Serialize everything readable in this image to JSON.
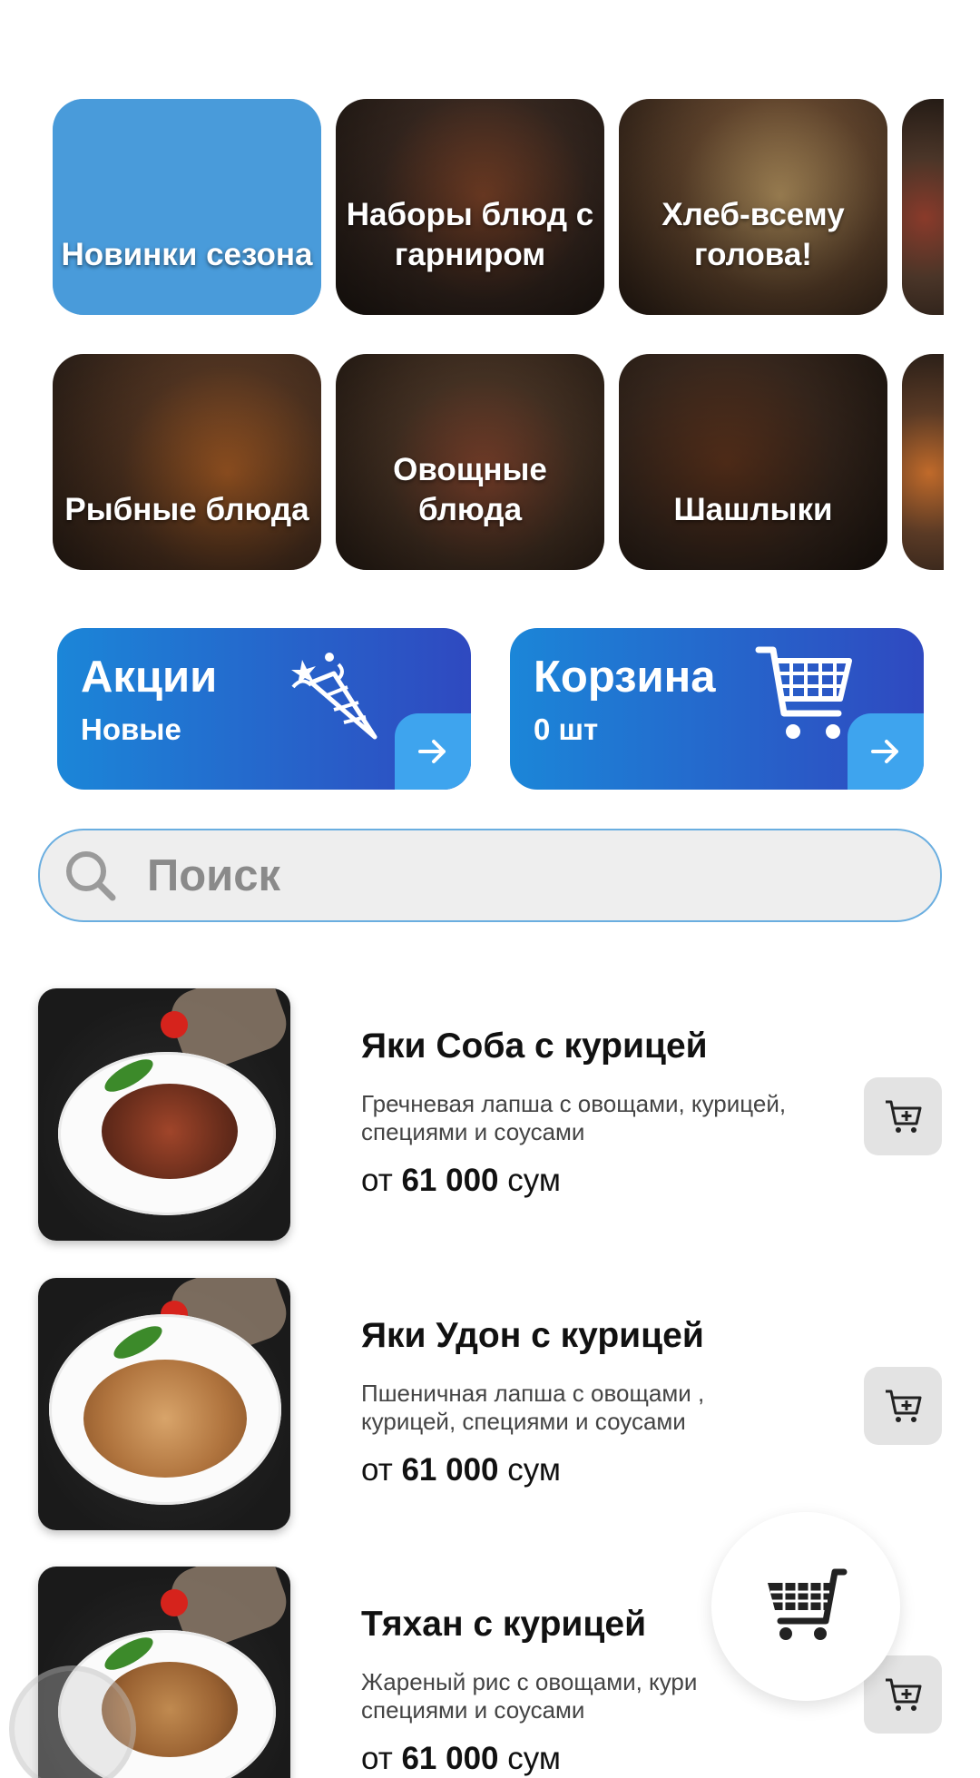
{
  "categories": {
    "row1": [
      {
        "label": "Новинки сезона"
      },
      {
        "label": "Наборы блюд с гарниром"
      },
      {
        "label": "Хлеб-всему голова!"
      }
    ],
    "row2": [
      {
        "label": "Рыбные блюда"
      },
      {
        "label": "Овощные блюда"
      },
      {
        "label": "Шашлыки"
      }
    ]
  },
  "promos": {
    "sales": {
      "title": "Акции",
      "subtitle": "Новые"
    },
    "cart": {
      "title": "Корзина",
      "subtitle": "0 шт"
    }
  },
  "search": {
    "placeholder": "Поиск"
  },
  "products": [
    {
      "name": "Яки Соба с курицей",
      "description": "Гречневая лапша с овощами, курицей, специями и соусами",
      "price_prefix": "от",
      "price": "61 000",
      "currency": "сум"
    },
    {
      "name": "Яки Удон с курицей",
      "description": "Пшеничная лапша с овощами , курицей, специями и соусами",
      "price_prefix": "от",
      "price": "61 000",
      "currency": "сум"
    },
    {
      "name": "Тяхан с курицей",
      "description": "Жареный рис с овощами, кури специями и соусами",
      "price_prefix": "от",
      "price": "61 000",
      "currency": "сум"
    }
  ],
  "colors": {
    "accent_blue": "#1b86d8",
    "accent_indigo": "#2f49c0",
    "arrow_box": "#3ea4ee",
    "search_border": "#6aaee0"
  },
  "icons": {
    "promo_sales": "party-popper-icon",
    "promo_cart": "shopping-cart-icon",
    "arrow": "arrow-right-icon",
    "search": "search-icon",
    "add_to_cart": "cart-plus-icon",
    "fab": "shopping-cart-icon"
  }
}
